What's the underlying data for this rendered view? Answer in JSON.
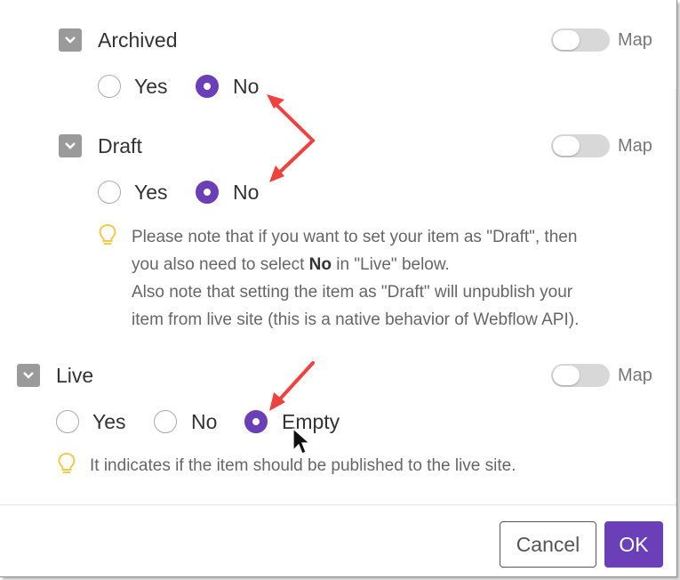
{
  "fields": {
    "archived": {
      "label": "Archived",
      "map_label": "Map",
      "yes_label": "Yes",
      "no_label": "No",
      "selected": "No"
    },
    "draft": {
      "label": "Draft",
      "map_label": "Map",
      "yes_label": "Yes",
      "no_label": "No",
      "selected": "No",
      "note_line1": "Please note that if you want to set your item as \"Draft\", then",
      "note_line2_a": "you also need to select ",
      "note_line2_bold": "No",
      "note_line2_b": " in \"Live\" below.",
      "note_line3": "Also note that setting the item as \"Draft\" will unpublish your",
      "note_line4": "item from live site (this is a native behavior of Webflow API)."
    },
    "live": {
      "label": "Live",
      "map_label": "Map",
      "yes_label": "Yes",
      "no_label": "No",
      "empty_label": "Empty",
      "selected": "Empty",
      "note": "It indicates if the item should be published to the live site."
    }
  },
  "footer": {
    "cancel_label": "Cancel",
    "ok_label": "OK"
  },
  "colors": {
    "accent": "#6a3fb8",
    "annotation_arrow": "#f0413f",
    "bulb": "#f2c94c"
  },
  "icons": {
    "chevron": "chevron-down-icon",
    "bulb": "lightbulb-icon",
    "cursor": "mouse-pointer-icon"
  }
}
